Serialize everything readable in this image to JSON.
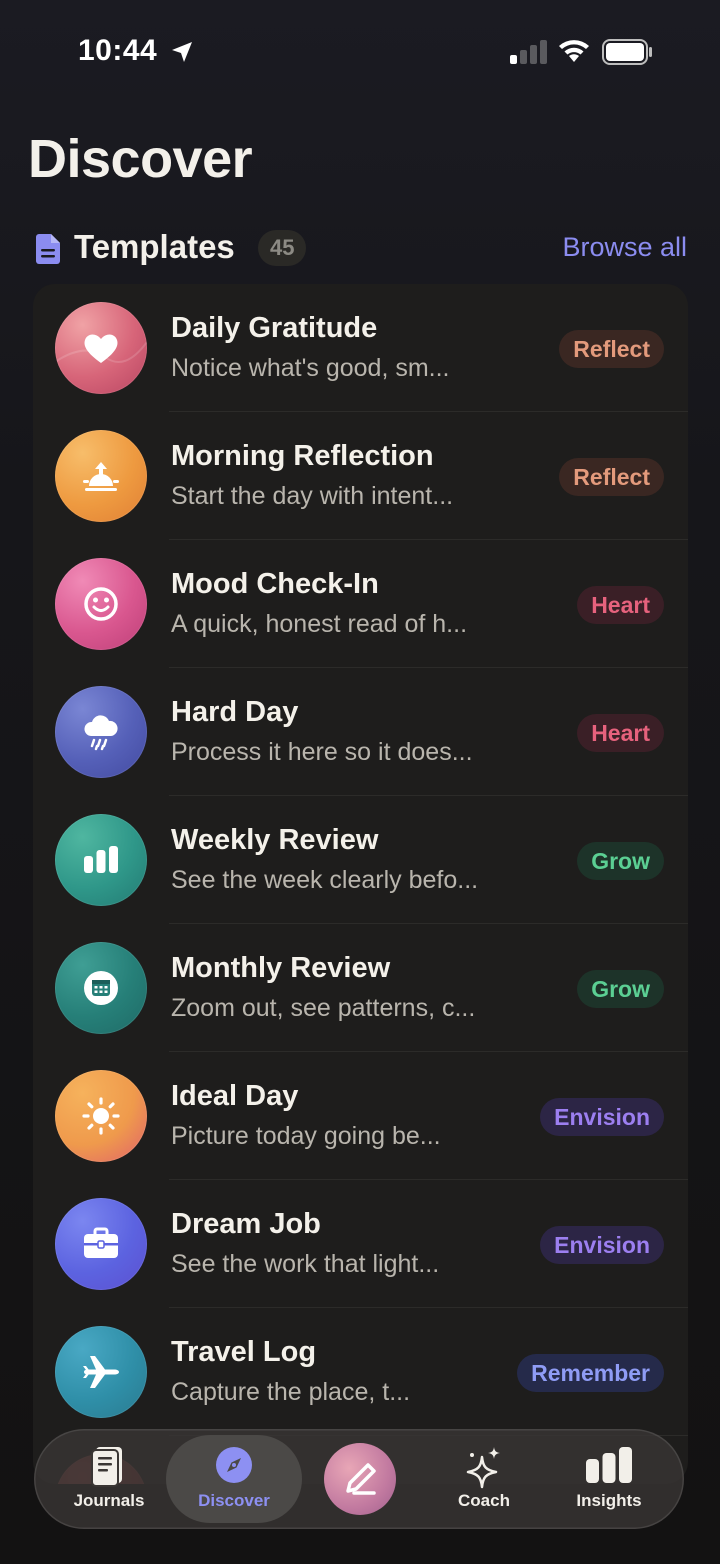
{
  "status_bar": {
    "time": "10:44"
  },
  "page": {
    "title": "Discover"
  },
  "templates_section": {
    "title": "Templates",
    "count": "45",
    "browse_all": "Browse all"
  },
  "templates": [
    {
      "title": "Daily Gratitude",
      "subtitle": "Notice what's good, sm...",
      "tag": "Reflect",
      "icon": "heart-icon"
    },
    {
      "title": "Morning Reflection",
      "subtitle": "Start the day with intent...",
      "tag": "Reflect",
      "icon": "sunrise-icon"
    },
    {
      "title": "Mood Check-In",
      "subtitle": "A quick, honest read of h...",
      "tag": "Heart",
      "icon": "smiley-icon"
    },
    {
      "title": "Hard Day",
      "subtitle": "Process it here so it does...",
      "tag": "Heart",
      "icon": "rain-cloud-icon"
    },
    {
      "title": "Weekly Review",
      "subtitle": "See the week clearly befo...",
      "tag": "Grow",
      "icon": "bar-chart-icon"
    },
    {
      "title": "Monthly Review",
      "subtitle": "Zoom out, see patterns, c...",
      "tag": "Grow",
      "icon": "calendar-icon"
    },
    {
      "title": "Ideal Day",
      "subtitle": "Picture today going be...",
      "tag": "Envision",
      "icon": "sun-icon"
    },
    {
      "title": "Dream Job",
      "subtitle": "See the work that light...",
      "tag": "Envision",
      "icon": "briefcase-icon"
    },
    {
      "title": "Travel Log",
      "subtitle": "Capture the place, t...",
      "tag": "Remember",
      "icon": "airplane-icon"
    }
  ],
  "tab_bar": {
    "journals": "Journals",
    "discover": "Discover",
    "coach": "Coach",
    "insights": "Insights"
  },
  "colors": {
    "accent": "#8b8cf0",
    "background": "#141416",
    "card": "#1e1d1c"
  }
}
